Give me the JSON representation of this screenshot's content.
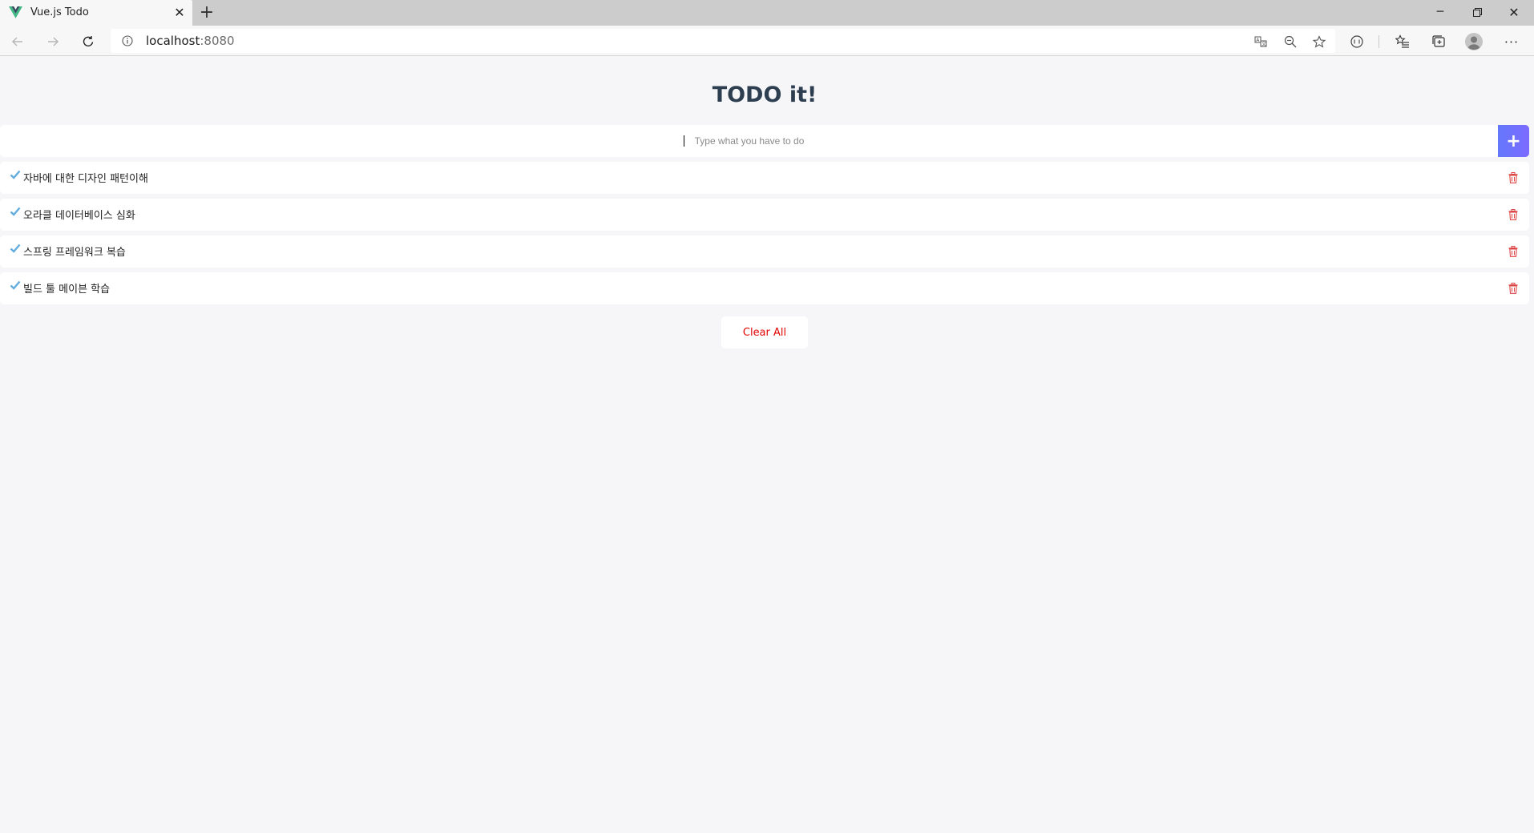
{
  "browser": {
    "tab_title": "Vue.js Todo",
    "url_host": "localhost",
    "url_port": ":8080",
    "icons": [
      "vue-logo-icon",
      "close-icon",
      "plus-icon",
      "back-icon",
      "forward-icon",
      "refresh-icon",
      "info-icon",
      "translate-icon",
      "zoom-out-icon",
      "star-icon",
      "reading-view-icon",
      "favorites-icon",
      "collections-icon",
      "profile-icon",
      "more-icon",
      "minimize-icon",
      "restore-icon",
      "window-close-icon"
    ]
  },
  "app": {
    "title": "TODO it!",
    "input_placeholder": "Type what you have to do",
    "add_label": "+",
    "clear_label": "Clear All",
    "accent_color": "#6478fb",
    "check_color": "#62acde",
    "delete_color": "#de4343"
  },
  "todos": [
    {
      "text": "자바에 대한 디자인 패턴이해"
    },
    {
      "text": "오라클 데이터베이스 심화"
    },
    {
      "text": "스프링 프레임워크 복습"
    },
    {
      "text": "빌드 툴 메이븐 학습"
    }
  ]
}
